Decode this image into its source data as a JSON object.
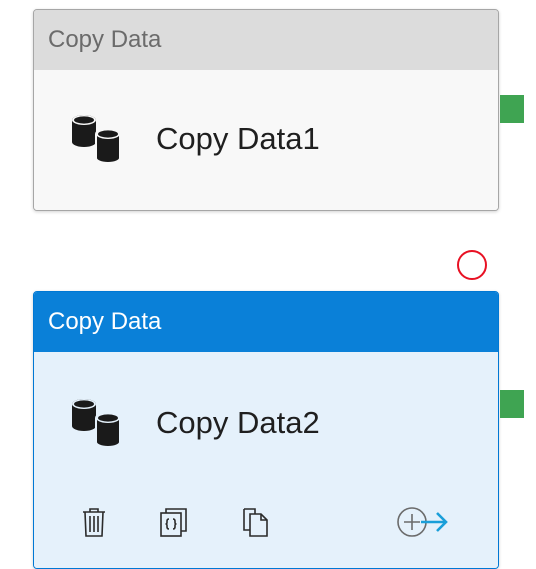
{
  "activities": [
    {
      "header": "Copy Data",
      "name": "Copy Data1",
      "icon": "database-icon",
      "selected": false
    },
    {
      "header": "Copy Data",
      "name": "Copy Data2",
      "icon": "database-icon",
      "selected": true,
      "actions": [
        {
          "icon": "trash-icon"
        },
        {
          "icon": "code-icon"
        },
        {
          "icon": "copy-icon"
        },
        {
          "icon": "add-output-icon"
        }
      ]
    }
  ],
  "colors": {
    "selected_header": "#0a80d8",
    "selected_body": "#e5f1fb",
    "default_header": "#dcdcdc",
    "success_connector": "#3fa452",
    "validation_error": "#e81123",
    "add_arrow": "#1a9fd9"
  }
}
